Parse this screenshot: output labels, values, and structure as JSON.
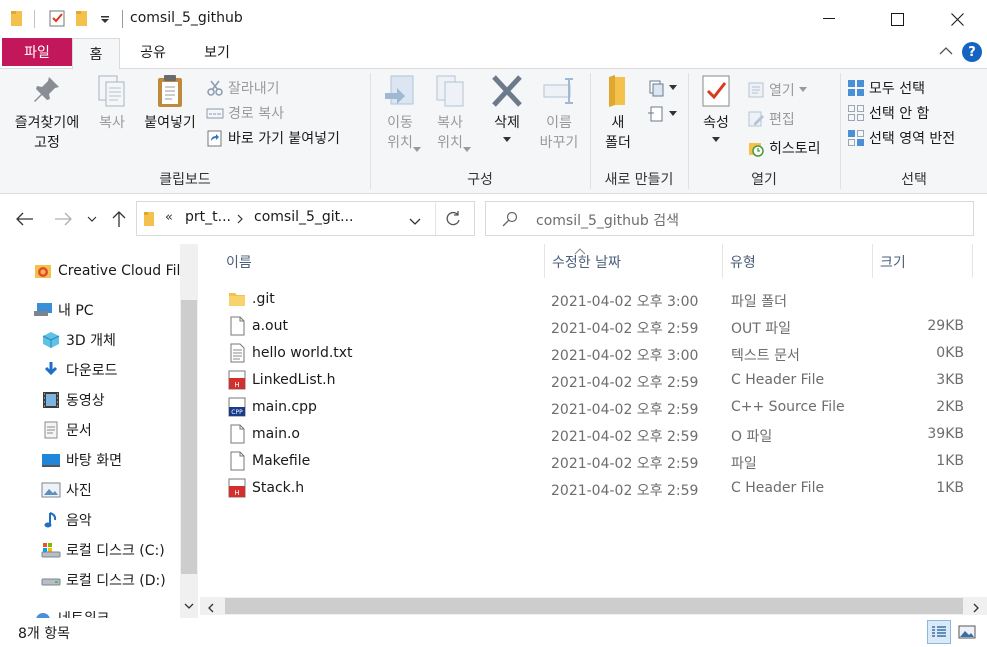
{
  "window": {
    "title": "comsil_5_github"
  },
  "ribbon_tabs": [
    "파일",
    "홈",
    "공유",
    "보기"
  ],
  "ribbon": {
    "clipboard": {
      "pin_line1": "즐겨찾기에",
      "pin_line2": "고정",
      "copy": "복사",
      "paste": "붙여넣기",
      "cut": "잘라내기",
      "copy_path": "경로 복사",
      "paste_shortcut": "바로 가기 붙여넣기",
      "label": "클립보드"
    },
    "organize": {
      "move_line1": "이동",
      "move_line2": "위치",
      "copyto_line1": "복사",
      "copyto_line2": "위치",
      "delete": "삭제",
      "rename_line1": "이름",
      "rename_line2": "바꾸기",
      "label": "구성"
    },
    "new": {
      "folder_line1": "새",
      "folder_line2": "폴더",
      "label": "새로 만들기"
    },
    "open": {
      "properties": "속성",
      "open": "열기",
      "edit": "편집",
      "history": "히스토리",
      "label": "열기"
    },
    "select": {
      "select_all": "모두 선택",
      "select_none": "선택 안 함",
      "invert": "선택 영역 반전",
      "label": "선택"
    }
  },
  "address": {
    "overflow": "«",
    "segments": [
      "prt_t...",
      "comsil_5_git..."
    ],
    "search_placeholder": "comsil_5_github 검색"
  },
  "nav_pane": {
    "items": [
      {
        "label": "Creative Cloud Fil",
        "icon": "creative-cloud-icon"
      },
      {
        "label": "내 PC",
        "icon": "pc-icon"
      },
      {
        "label": "3D 개체",
        "icon": "3d-objects-icon"
      },
      {
        "label": "다운로드",
        "icon": "download-icon"
      },
      {
        "label": "동영상",
        "icon": "video-icon"
      },
      {
        "label": "문서",
        "icon": "documents-icon"
      },
      {
        "label": "바탕 화면",
        "icon": "desktop-icon"
      },
      {
        "label": "사진",
        "icon": "pictures-icon"
      },
      {
        "label": "음악",
        "icon": "music-icon"
      },
      {
        "label": "로컬 디스크 (C:)",
        "icon": "drive-c-icon"
      },
      {
        "label": "로컬 디스크 (D:)",
        "icon": "drive-d-icon"
      },
      {
        "label": "네트워크",
        "icon": "network-icon"
      }
    ]
  },
  "columns": {
    "name": "이름",
    "date": "수정한 날짜",
    "type": "유형",
    "size": "크기"
  },
  "files": [
    {
      "name": ".git",
      "date": "2021-04-02 오후 3:00",
      "type": "파일 폴더",
      "size": "",
      "icon": "folder-icon"
    },
    {
      "name": "a.out",
      "date": "2021-04-02 오후 2:59",
      "type": "OUT 파일",
      "size": "29KB",
      "icon": "blank-file-icon"
    },
    {
      "name": "hello world.txt",
      "date": "2021-04-02 오후 3:00",
      "type": "텍스트 문서",
      "size": "0KB",
      "icon": "text-file-icon"
    },
    {
      "name": "LinkedList.h",
      "date": "2021-04-02 오후 2:59",
      "type": "C Header File",
      "size": "3KB",
      "icon": "c-header-icon"
    },
    {
      "name": "main.cpp",
      "date": "2021-04-02 오후 2:59",
      "type": "C++ Source File",
      "size": "2KB",
      "icon": "cpp-file-icon"
    },
    {
      "name": "main.o",
      "date": "2021-04-02 오후 2:59",
      "type": "O 파일",
      "size": "39KB",
      "icon": "blank-file-icon"
    },
    {
      "name": "Makefile",
      "date": "2021-04-02 오후 2:59",
      "type": "파일",
      "size": "1KB",
      "icon": "blank-file-icon"
    },
    {
      "name": "Stack.h",
      "date": "2021-04-02 오후 2:59",
      "type": "C Header File",
      "size": "1KB",
      "icon": "c-header-icon"
    }
  ],
  "status": {
    "item_count": "8개 항목"
  },
  "colors": {
    "file_tab": "#c2185b",
    "folder": "#f4c24c",
    "accent": "#1565c0"
  }
}
